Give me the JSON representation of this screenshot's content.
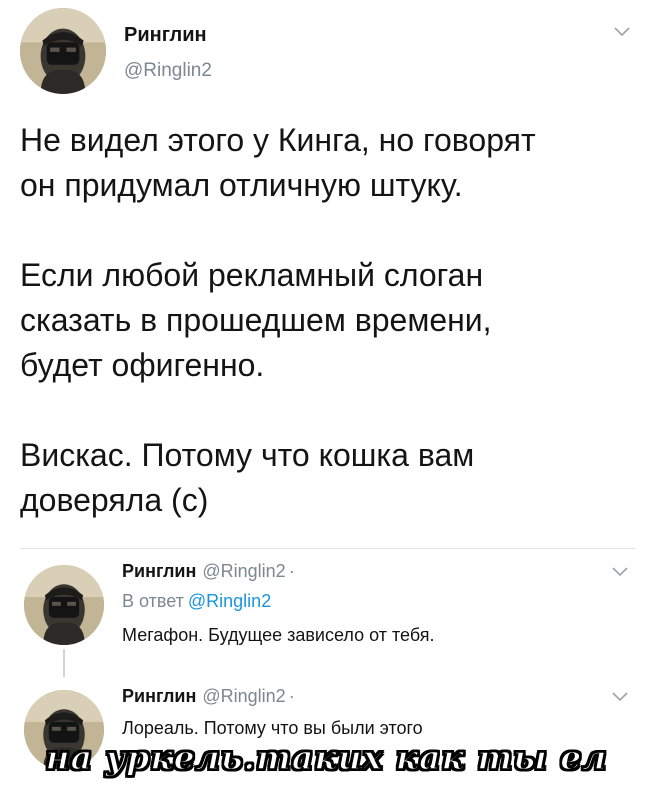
{
  "main_tweet": {
    "author_name": "Ринглин",
    "author_handle": "@Ringlin2",
    "avatar_icon": "masked-person-avatar",
    "menu_icon": "chevron-down-icon",
    "paragraphs": [
      [
        "Не видел этого у Кинга, но говорят",
        "он придумал отличную штуку."
      ],
      [
        "Если любой рекламный слоган",
        "сказать в прошедшем времени,",
        "будет офигенно."
      ],
      [
        "Вискас. Потому что кошка вам",
        "доверяла (с)"
      ]
    ]
  },
  "replies": [
    {
      "author_name": "Ринглин",
      "author_handle": "@Ringlin2",
      "separator": "·",
      "reply_to_prefix": "В ответ",
      "reply_to_handle": "@Ringlin2",
      "text": "Мегафон. Будущее зависело от тебя."
    },
    {
      "author_name": "Ринглин",
      "author_handle": "@Ringlin2",
      "separator": "·",
      "text": "Лореаль. Потому что вы были этого"
    }
  ],
  "overlay_caption": "на уркель.таких как ты ел",
  "colors": {
    "text": "#141414",
    "secondary": "#7d8790",
    "link": "#1b95e0",
    "divider": "#e3e6e8"
  }
}
